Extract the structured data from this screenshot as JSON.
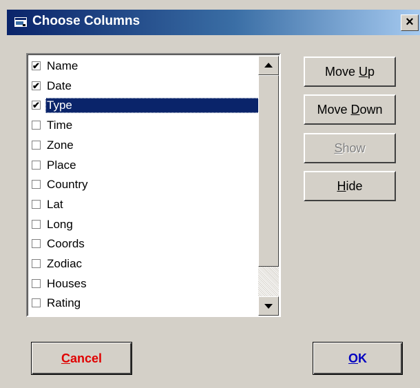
{
  "window": {
    "title": "Choose Columns",
    "close_glyph": "×",
    "icon": "app-icon"
  },
  "list": {
    "items": [
      {
        "label": "Name",
        "checked": true
      },
      {
        "label": "Date",
        "checked": true
      },
      {
        "label": "Type",
        "checked": true,
        "selected": true
      },
      {
        "label": "Time",
        "checked": false
      },
      {
        "label": "Zone",
        "checked": false
      },
      {
        "label": "Place",
        "checked": false
      },
      {
        "label": "Country",
        "checked": false
      },
      {
        "label": "Lat",
        "checked": false
      },
      {
        "label": "Long",
        "checked": false
      },
      {
        "label": "Coords",
        "checked": false
      },
      {
        "label": "Zodiac",
        "checked": false
      },
      {
        "label": "Houses",
        "checked": false
      },
      {
        "label": "Rating",
        "checked": false
      }
    ],
    "check_glyph": "✔"
  },
  "buttons": {
    "move_up": {
      "pre": "Move ",
      "accel": "U",
      "post": "p"
    },
    "move_down": {
      "pre": "Move ",
      "accel": "D",
      "post": "own"
    },
    "show": {
      "pre": "",
      "accel": "S",
      "post": "how"
    },
    "hide": {
      "pre": "",
      "accel": "H",
      "post": "ide"
    },
    "cancel": {
      "pre": "",
      "accel": "C",
      "post": "ancel"
    },
    "ok": {
      "pre": "",
      "accel": "O",
      "post": "K"
    }
  },
  "colors": {
    "titlebar_start": "#0a246a",
    "selection": "#0a246a",
    "cancel_text": "#e00000",
    "ok_text": "#0000c0"
  }
}
